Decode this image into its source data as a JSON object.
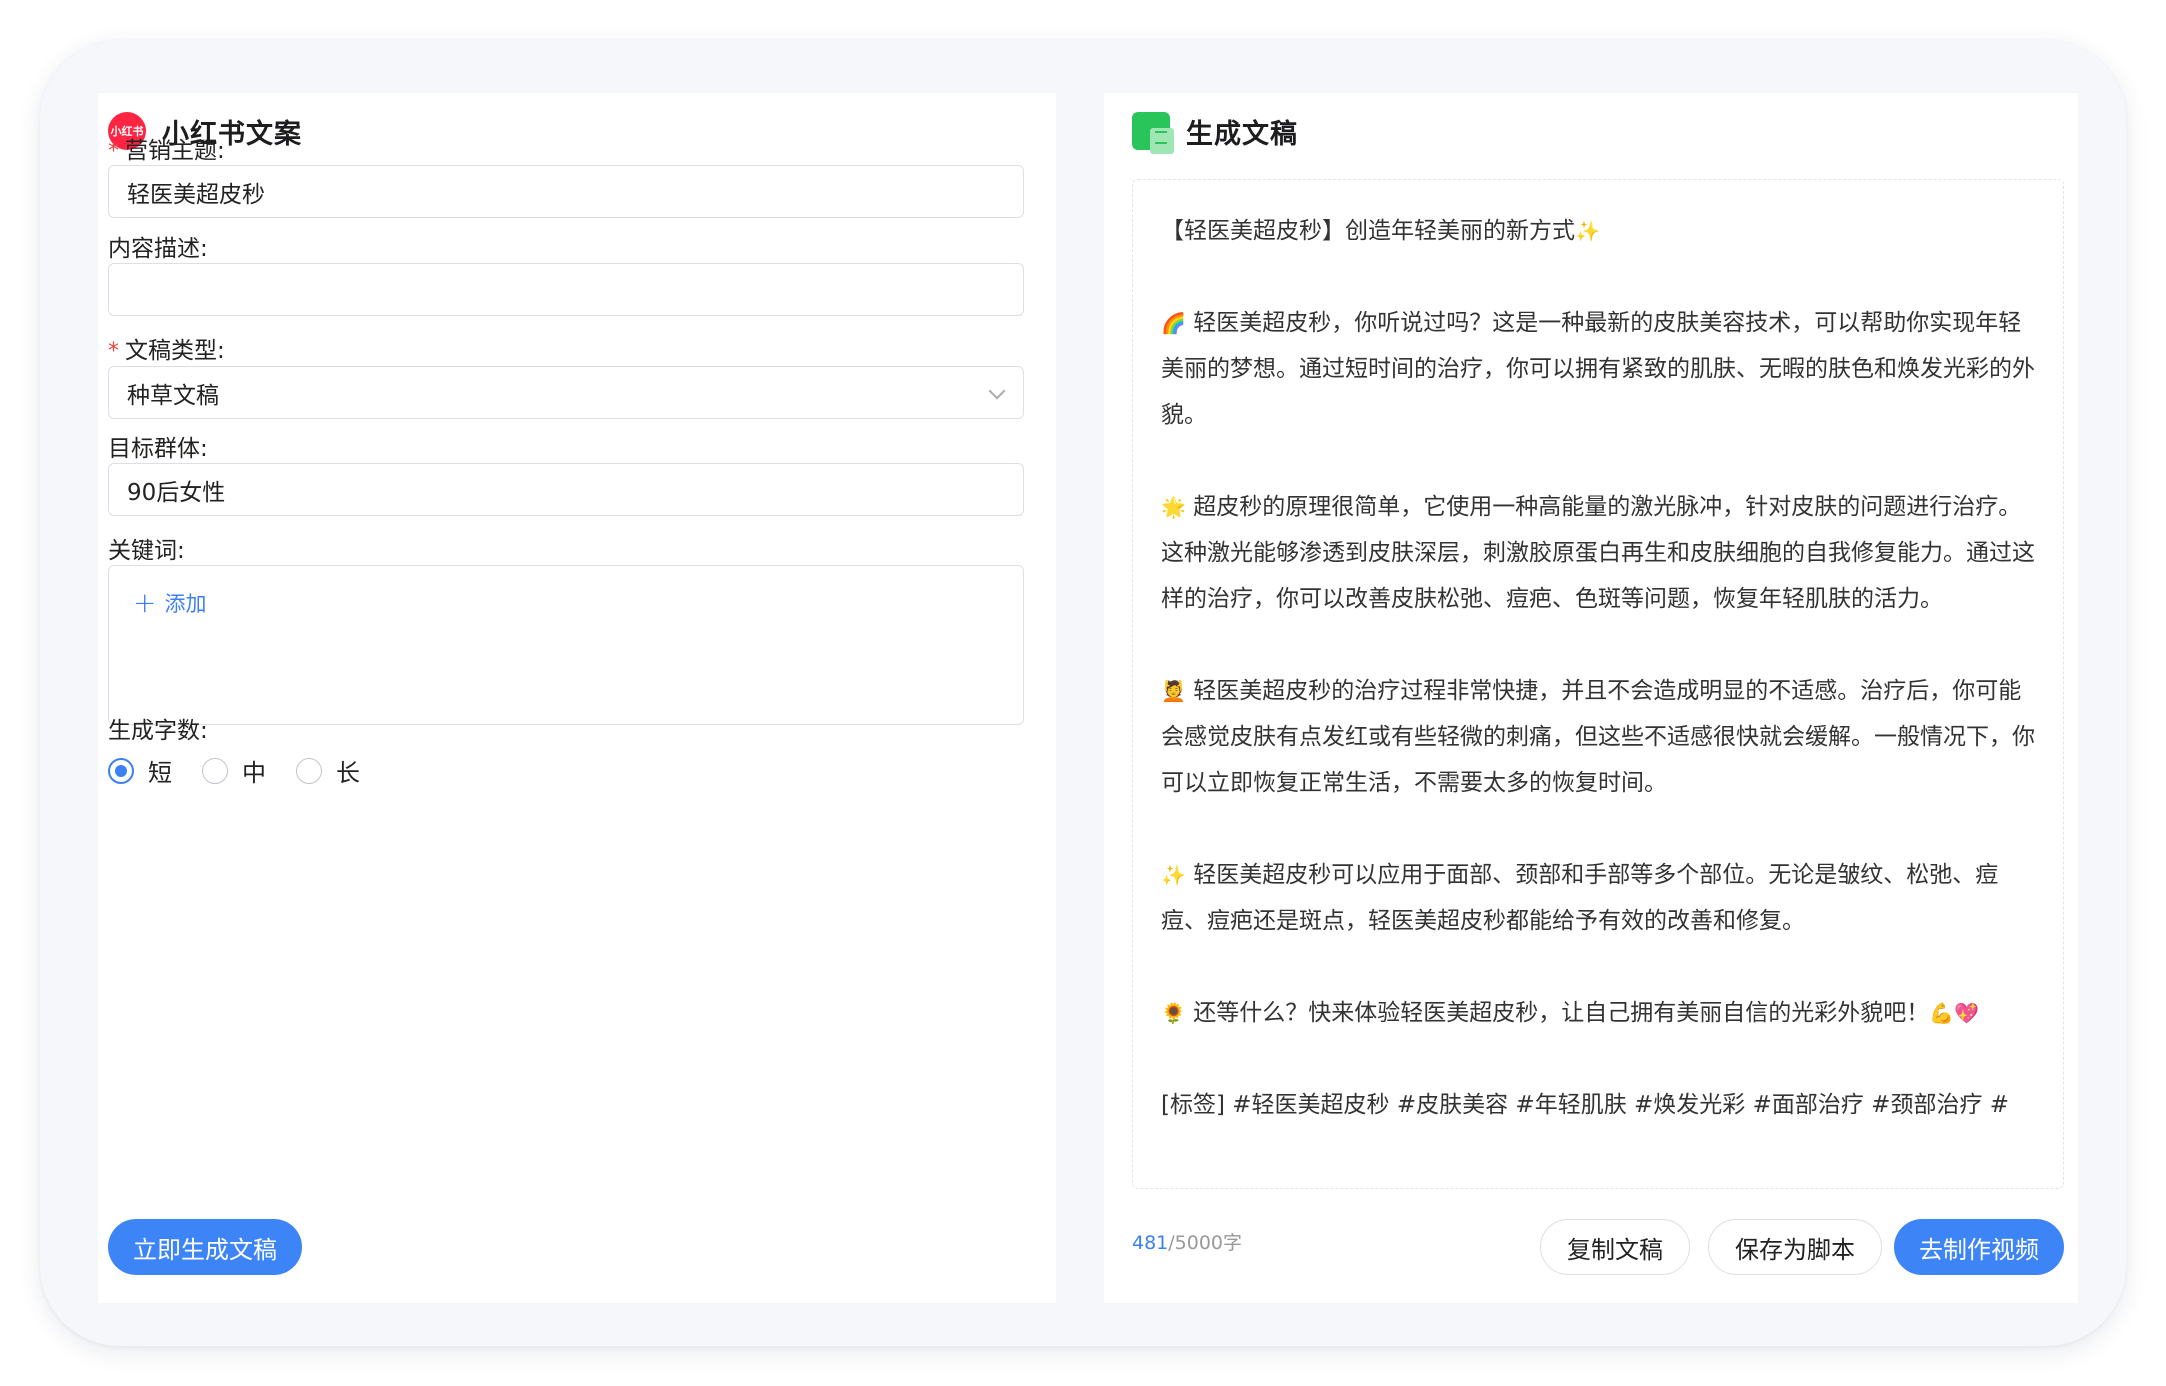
{
  "left": {
    "logo_text": "小红书",
    "title": "小红书文案",
    "topic": {
      "label": "营销主题:",
      "value": "轻医美超皮秒"
    },
    "description": {
      "label": "内容描述:",
      "value": ""
    },
    "type": {
      "label": "文稿类型:",
      "value": "种草文稿"
    },
    "audience": {
      "label": "目标群体:",
      "value": "90后女性"
    },
    "keywords": {
      "label": "关键词:",
      "add_label": "添加"
    },
    "length": {
      "label": "生成字数:",
      "options": [
        "短",
        "中",
        "长"
      ],
      "selected": "短"
    },
    "generate_label": "立即生成文稿"
  },
  "right": {
    "title": "生成文稿",
    "paragraphs": [
      {
        "emoji": "",
        "text": "【轻医美超皮秒】创造年轻美丽的新方式",
        "trailing_emoji": "✨"
      },
      {
        "emoji": "🌈",
        "text": "轻医美超皮秒，你听说过吗？这是一种最新的皮肤美容技术，可以帮助你实现年轻美丽的梦想。通过短时间的治疗，你可以拥有紧致的肌肤、无暇的肤色和焕发光彩的外貌。",
        "trailing_emoji": ""
      },
      {
        "emoji": "🌟",
        "text": "超皮秒的原理很简单，它使用一种高能量的激光脉冲，针对皮肤的问题进行治疗。这种激光能够渗透到皮肤深层，刺激胶原蛋白再生和皮肤细胞的自我修复能力。通过这样的治疗，你可以改善皮肤松弛、痘疤、色斑等问题，恢复年轻肌肤的活力。",
        "trailing_emoji": ""
      },
      {
        "emoji": "💆",
        "text": "轻医美超皮秒的治疗过程非常快捷，并且不会造成明显的不适感。治疗后，你可能会感觉皮肤有点发红或有些轻微的刺痛，但这些不适感很快就会缓解。一般情况下，你可以立即恢复正常生活，不需要太多的恢复时间。",
        "trailing_emoji": ""
      },
      {
        "emoji": "✨",
        "text": "轻医美超皮秒可以应用于面部、颈部和手部等多个部位。无论是皱纹、松弛、痘痘、痘疤还是斑点，轻医美超皮秒都能给予有效的改善和修复。",
        "trailing_emoji": ""
      },
      {
        "emoji": "🌻",
        "text": "还等什么？快来体验轻医美超皮秒，让自己拥有美丽自信的光彩外貌吧！",
        "trailing_emoji": "💪💖"
      }
    ],
    "tags": "[标签] #轻医美超皮秒 #皮肤美容 #年轻肌肤 #焕发光彩 #面部治疗 #颈部治疗 #",
    "count_current": "481",
    "count_suffix": "/5000字",
    "copy_label": "复制文稿",
    "save_label": "保存为脚本",
    "video_label": "去制作视频"
  }
}
